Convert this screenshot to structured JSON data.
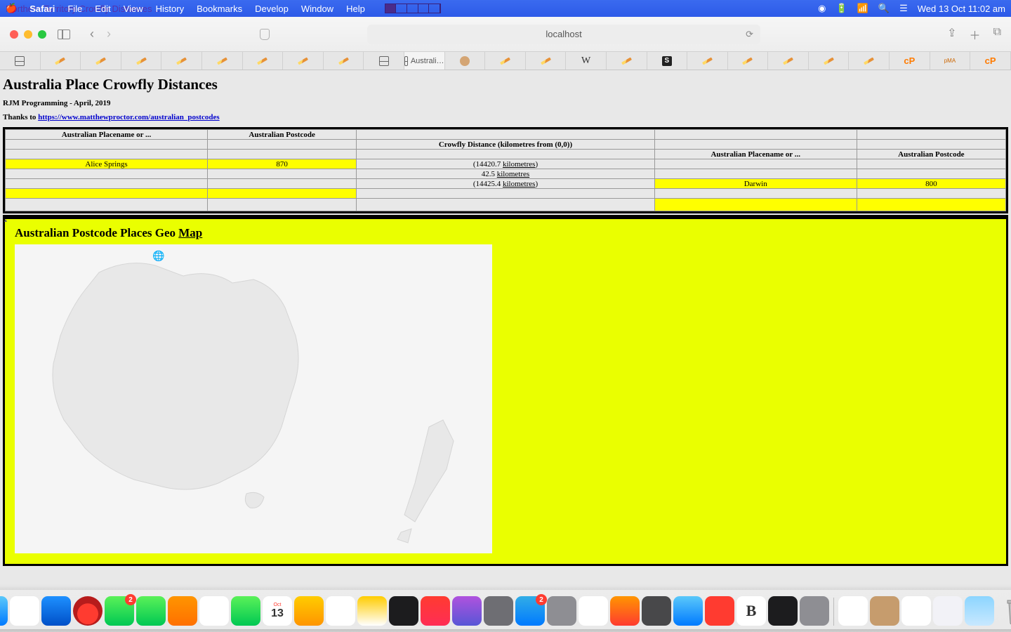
{
  "menubar": {
    "ghost_text": "Northern Territory Crowfly Distances ...",
    "items": [
      "Safari",
      "File",
      "Edit",
      "View",
      "History",
      "Bookmarks",
      "Develop",
      "Window",
      "Help"
    ],
    "clock": "Wed 13 Oct  11:02 am"
  },
  "browser": {
    "url": "localhost",
    "active_tab_label": "Australi…"
  },
  "page": {
    "title": "Australia Place Crowfly Distances",
    "byline": "RJM Programming - April, 2019",
    "thanks_prefix": "Thanks to ",
    "thanks_link": "https://www.matthewproctor.com/australian_postcodes",
    "headers": {
      "place_left": "Australian Placename or ...",
      "postcode_left": "Australian Postcode",
      "distance": "Crowfly Distance (kilometres from (0,0))",
      "place_right": "Australian Placename or ...",
      "postcode_right": "Australian Postcode"
    },
    "row_left": {
      "place": "Alice Springs",
      "postcode": "870"
    },
    "row_right": {
      "place": "Darwin",
      "postcode": "800"
    },
    "dist1_pre": "(14420.7 ",
    "dist1_link": "kilometres",
    "dist1_post": ")",
    "dist2_pre": "42.5 ",
    "dist2_link": "kilometres",
    "dist3_pre": "(14425.4 ",
    "dist3_link": "kilometres",
    "dist3_post": ")",
    "map_title_a": "Australian Postcode Places Geo ",
    "map_title_b": "Map"
  },
  "dock": {
    "badges": {
      "messages": "2",
      "appstore": "2"
    },
    "cal_month": "Oct",
    "cal_day": "13"
  }
}
